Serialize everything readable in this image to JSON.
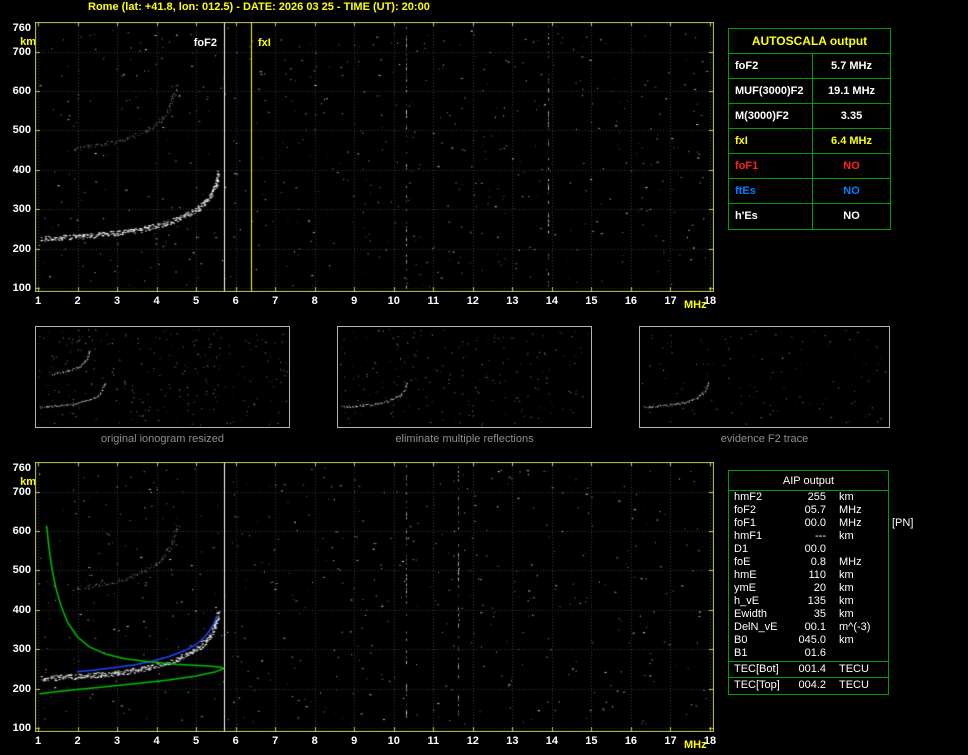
{
  "title": "Rome (lat: +41.8, lon: 012.5) - DATE: 2026 03 25 - TIME (UT): 20:00",
  "colors": {
    "background": "#000000",
    "title": "#ffff00",
    "plot_frame": "#c9c955",
    "grid": "#3a3a3a",
    "table_border": "#00a000",
    "caption": "#8f8f8f",
    "profile_green": "#00c000",
    "fitted_blue": "#2244ff"
  },
  "autoscala_table": {
    "header": "AUTOSCALA output",
    "rows": [
      {
        "label": "foF2",
        "value": "5.7 MHz",
        "color": "#ffffff"
      },
      {
        "label": "MUF(3000)F2",
        "value": "19.1 MHz",
        "color": "#ffffff"
      },
      {
        "label": "M(3000)F2",
        "value": "3.35",
        "color": "#ffffff"
      },
      {
        "label": "fxI",
        "value": "6.4 MHz",
        "color": "#ffff00"
      },
      {
        "label": "foF1",
        "value": "NO",
        "color": "#ff2020"
      },
      {
        "label": "ftEs",
        "value": "NO",
        "color": "#0080ff"
      },
      {
        "label": "h'Es",
        "value": "NO",
        "color": "#ffffff"
      }
    ]
  },
  "aip_table": {
    "header": "AIP output",
    "rows": [
      {
        "name": "hmF2",
        "value": "255",
        "unit": "km"
      },
      {
        "name": "foF2",
        "value": "05.7",
        "unit": "MHz"
      },
      {
        "name": "foF1",
        "value": "00.0",
        "unit": "MHz",
        "extra": "[PN]"
      },
      {
        "name": "hmF1",
        "value": "---",
        "unit": "km"
      },
      {
        "name": "D1",
        "value": "00.0",
        "unit": ""
      },
      {
        "name": "foE",
        "value": "0.8",
        "unit": "MHz"
      },
      {
        "name": "hmE",
        "value": "110",
        "unit": "km"
      },
      {
        "name": "ymE",
        "value": "20",
        "unit": "km"
      },
      {
        "name": "h_vE",
        "value": "135",
        "unit": "km"
      },
      {
        "name": "Ewidth",
        "value": "35",
        "unit": "km"
      },
      {
        "name": "DelN_vE",
        "value": "00.1",
        "unit": "m^(-3)"
      },
      {
        "name": "B0",
        "value": "045.0",
        "unit": "km"
      },
      {
        "name": "B1",
        "value": "01.6",
        "unit": ""
      }
    ],
    "tec_rows": [
      {
        "name": "TEC[Bot]",
        "value": "001.4",
        "unit": "TECU"
      },
      {
        "name": "TEC[Top]",
        "value": "004.2",
        "unit": "TECU"
      }
    ]
  },
  "panels": [
    {
      "caption": "original ionogram resized"
    },
    {
      "caption": "eliminate multiple reflections"
    },
    {
      "caption": "evidence F2 trace"
    }
  ],
  "chart_data": [
    {
      "id": "scaled-ionogram",
      "type": "scatter",
      "title": "",
      "xlabel": "MHz",
      "ylabel": "km",
      "xlim": [
        1,
        18
      ],
      "ylim": [
        100,
        760
      ],
      "grid": true,
      "x_ticks": [
        1,
        2,
        3,
        4,
        5,
        6,
        7,
        8,
        9,
        10,
        11,
        12,
        13,
        14,
        15,
        16,
        17,
        18
      ],
      "y_ticks": [
        760,
        700,
        600,
        500,
        400,
        300,
        200,
        100
      ],
      "markers": [
        {
          "label": "foF2",
          "MHz": 5.7,
          "color": "#ffffff"
        },
        {
          "label": "fxI",
          "MHz": 6.4,
          "color": "#ffff00"
        }
      ],
      "series": [
        {
          "name": "F2 trace",
          "type": "scatter",
          "weight": "strong",
          "points": [
            [
              1.1,
              226
            ],
            [
              1.6,
              229
            ],
            [
              2.1,
              232
            ],
            [
              2.6,
              236
            ],
            [
              3.0,
              240
            ],
            [
              3.4,
              246
            ],
            [
              3.8,
              254
            ],
            [
              4.2,
              264
            ],
            [
              4.5,
              275
            ],
            [
              4.8,
              289
            ],
            [
              5.05,
              303
            ],
            [
              5.2,
              318
            ],
            [
              5.35,
              336
            ],
            [
              5.45,
              356
            ],
            [
              5.52,
              376
            ],
            [
              5.56,
              393
            ]
          ]
        },
        {
          "name": "second reflection",
          "type": "scatter",
          "weight": "faint",
          "points": [
            [
              1.9,
              452
            ],
            [
              2.3,
              460
            ],
            [
              2.7,
              467
            ],
            [
              3.1,
              476
            ],
            [
              3.4,
              486
            ],
            [
              3.7,
              499
            ],
            [
              3.95,
              514
            ],
            [
              4.15,
              532
            ],
            [
              4.3,
              553
            ],
            [
              4.4,
              578
            ],
            [
              4.46,
              602
            ],
            [
              4.5,
              618
            ]
          ]
        }
      ]
    },
    {
      "id": "profile-and-fit-ionogram",
      "type": "scatter",
      "title": "",
      "xlabel": "MHz",
      "ylabel": "km",
      "xlim": [
        1,
        18
      ],
      "ylim": [
        100,
        760
      ],
      "grid": true,
      "x_ticks": [
        1,
        2,
        3,
        4,
        5,
        6,
        7,
        8,
        9,
        10,
        11,
        12,
        13,
        14,
        15,
        16,
        17,
        18
      ],
      "y_ticks": [
        760,
        700,
        600,
        500,
        400,
        300,
        200,
        100
      ],
      "markers": [
        {
          "label": "",
          "MHz": 5.7,
          "color": "#ffffff"
        }
      ],
      "series": [
        {
          "name": "F2 trace",
          "type": "scatter",
          "weight": "strong",
          "points": [
            [
              1.1,
              226
            ],
            [
              1.6,
              229
            ],
            [
              2.1,
              232
            ],
            [
              2.6,
              236
            ],
            [
              3.0,
              240
            ],
            [
              3.4,
              246
            ],
            [
              3.8,
              254
            ],
            [
              4.2,
              264
            ],
            [
              4.5,
              275
            ],
            [
              4.8,
              289
            ],
            [
              5.05,
              303
            ],
            [
              5.2,
              318
            ],
            [
              5.35,
              336
            ],
            [
              5.45,
              356
            ],
            [
              5.52,
              376
            ],
            [
              5.56,
              393
            ]
          ]
        },
        {
          "name": "second reflection",
          "type": "scatter",
          "weight": "faint",
          "points": [
            [
              1.9,
              452
            ],
            [
              2.3,
              460
            ],
            [
              2.7,
              467
            ],
            [
              3.1,
              476
            ],
            [
              3.4,
              486
            ],
            [
              3.7,
              499
            ],
            [
              3.95,
              514
            ],
            [
              4.15,
              532
            ],
            [
              4.3,
              553
            ],
            [
              4.4,
              578
            ],
            [
              4.46,
              602
            ],
            [
              4.5,
              618
            ]
          ]
        },
        {
          "name": "fitted F2 trace",
          "type": "line",
          "color": "#2244ff",
          "points": [
            [
              2.0,
              243
            ],
            [
              2.5,
              248
            ],
            [
              3.0,
              254
            ],
            [
              3.5,
              261
            ],
            [
              3.9,
              270
            ],
            [
              4.3,
              281
            ],
            [
              4.7,
              296
            ],
            [
              5.0,
              312
            ],
            [
              5.2,
              329
            ],
            [
              5.35,
              348
            ],
            [
              5.45,
              366
            ],
            [
              5.52,
              384
            ]
          ]
        },
        {
          "name": "electron density profile",
          "type": "line",
          "color": "#00c000",
          "points": [
            [
              1.22,
              612
            ],
            [
              1.28,
              556
            ],
            [
              1.35,
              506
            ],
            [
              1.45,
              456
            ],
            [
              1.58,
              411
            ],
            [
              1.75,
              368
            ],
            [
              2.0,
              331
            ],
            [
              2.3,
              306
            ],
            [
              2.7,
              288
            ],
            [
              3.2,
              276
            ],
            [
              3.8,
              268
            ],
            [
              4.5,
              262
            ],
            [
              5.2,
              258
            ],
            [
              5.6,
              255
            ],
            [
              5.7,
              251
            ],
            [
              5.5,
              243
            ],
            [
              5.0,
              232
            ],
            [
              4.3,
              222
            ],
            [
              3.5,
              213
            ],
            [
              2.7,
              205
            ],
            [
              2.0,
              198
            ],
            [
              1.45,
              192
            ],
            [
              1.05,
              187
            ]
          ]
        }
      ]
    }
  ]
}
